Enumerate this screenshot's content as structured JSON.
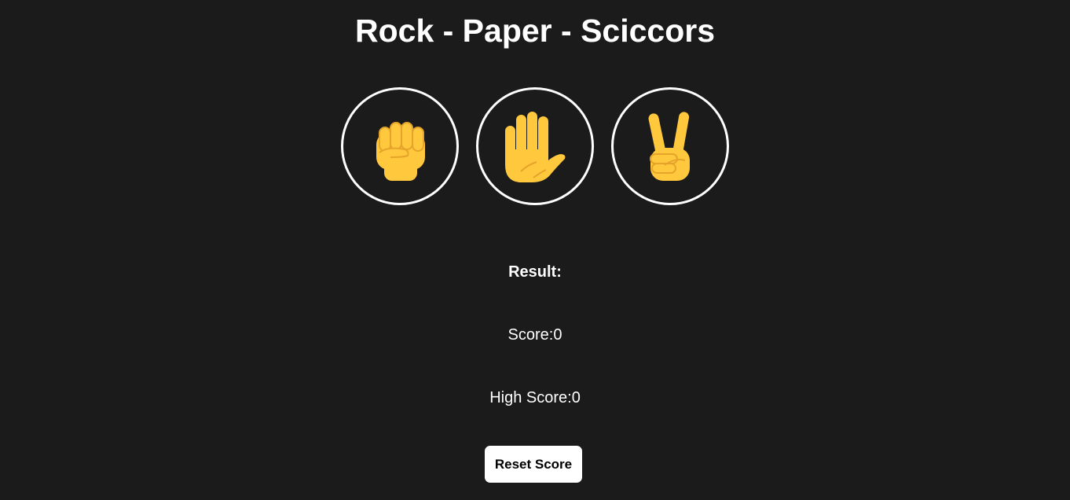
{
  "title": "Rock - Paper - Sciccors",
  "choices": [
    {
      "name": "rock",
      "icon": "raised-fist-icon"
    },
    {
      "name": "paper",
      "icon": "raised-hand-icon"
    },
    {
      "name": "scissors",
      "icon": "victory-hand-icon"
    }
  ],
  "result": {
    "label": "Result:"
  },
  "score": {
    "label": "Score:",
    "value": "0"
  },
  "high_score": {
    "label": "High Score:",
    "value": "0"
  },
  "reset_button": {
    "label": "Reset Score"
  },
  "colors": {
    "background": "#1b1b1b",
    "text": "#ffffff",
    "circle_border": "#ffffff",
    "emoji_skin": "#ffc83d",
    "emoji_outline": "#e6a42b",
    "button_bg": "#ffffff",
    "button_text": "#000000"
  }
}
